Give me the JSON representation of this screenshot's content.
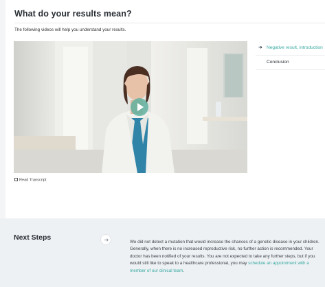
{
  "section": {
    "title": "What do your results mean?",
    "subtitle": "The following videos will help you understand your results."
  },
  "video": {
    "play_icon": "play-icon",
    "accent_color": "#60b1a0"
  },
  "transcript": {
    "label": "Read Transcript",
    "icon": "document-icon"
  },
  "playlist": {
    "items": [
      {
        "label": "Negative result, introduction",
        "active": true
      },
      {
        "label": "Conclusion",
        "active": false
      }
    ],
    "active_color": "#36a8a0"
  },
  "next_steps": {
    "title": "Next Steps",
    "icon": "arrow-right-icon",
    "body": "We did not detect a mutation that would increase the chances of a genetic disease in your children. Generally, when there is no increased reproductive risk, no further action is recommended. Your doctor has been notified of your results. You are not expected to take any further steps, but if you would still like to speak to a healthcare professional, you may",
    "link_text": "schedule an appointment with a member of our clinical team",
    "link_suffix": "."
  }
}
